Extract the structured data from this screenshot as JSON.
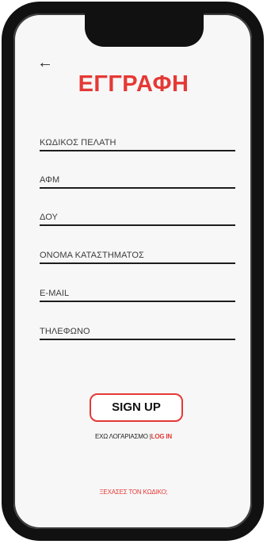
{
  "header": {
    "back_glyph": "←",
    "title": "ΕΓΓΡΑΦΗ"
  },
  "form": {
    "fields": [
      {
        "label": "ΚΩΔΙΚΟΣ ΠΕΛΑΤΗ"
      },
      {
        "label": "ΑΦΜ"
      },
      {
        "label": "ΔΟΥ"
      },
      {
        "label": "ΟΝΟΜΑ ΚΑΤΑΣΤΗΜΑΤΟΣ"
      },
      {
        "label": "E-MAIL"
      },
      {
        "label": "ΤΗΛΕΦΩΝΟ"
      }
    ],
    "signup_label": "SIGN UP"
  },
  "footer": {
    "have_account_text": "ΕΧΩ ΛΟΓΑΡΙΑΣΜΟ |",
    "login_link": "LOG IN",
    "forgot_code": "ΞΕΧΑΣΕΣ ΤΟΝ ΚΩΔΙΚΟ;"
  },
  "colors": {
    "accent": "#e53935",
    "frame": "#111111",
    "screen": "#f7f7f7"
  }
}
